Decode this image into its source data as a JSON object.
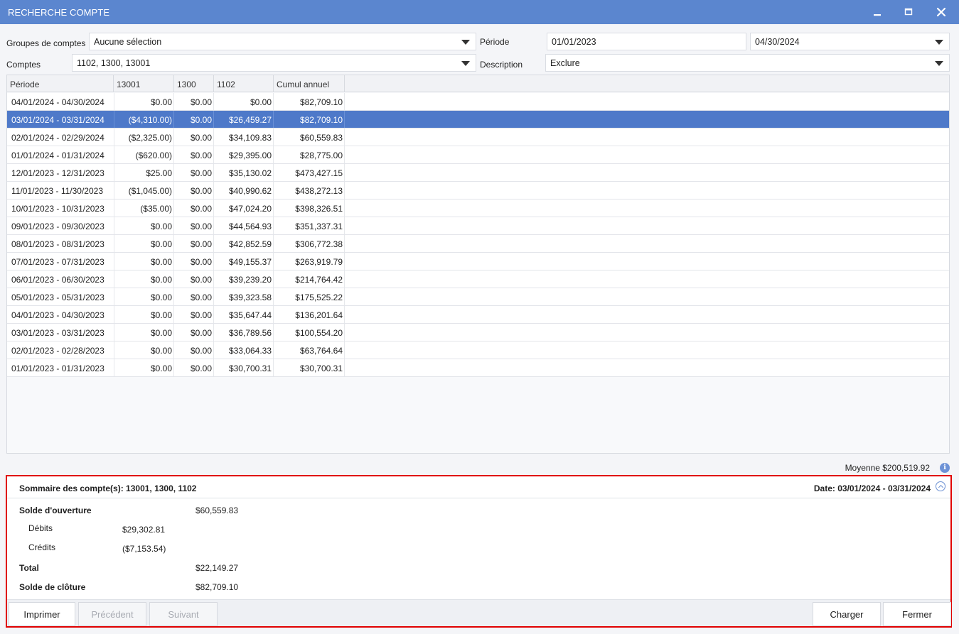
{
  "window": {
    "title": "RECHERCHE COMPTE",
    "minimize_icon": "minimize-icon",
    "maximize_icon": "maximize-icon",
    "close_icon": "close-icon"
  },
  "filters": {
    "account_groups_label": "Groupes de comptes",
    "account_groups_value": "Aucune sélection",
    "accounts_label": "Comptes",
    "accounts_value": "1102, 1300, 13001",
    "period_label": "Période",
    "period_start": "01/01/2023",
    "period_end": "04/30/2024",
    "description_label": "Description",
    "description_value": "Exclure"
  },
  "grid": {
    "columns": [
      "Période",
      "13001",
      "1300",
      "1102",
      "Cumul annuel"
    ],
    "selected_row": 1,
    "rows": [
      [
        "04/01/2024 - 04/30/2024",
        "$0.00",
        "$0.00",
        "$0.00",
        "$82,709.10"
      ],
      [
        "03/01/2024 - 03/31/2024",
        "($4,310.00)",
        "$0.00",
        "$26,459.27",
        "$82,709.10"
      ],
      [
        "02/01/2024 - 02/29/2024",
        "($2,325.00)",
        "$0.00",
        "$34,109.83",
        "$60,559.83"
      ],
      [
        "01/01/2024 - 01/31/2024",
        "($620.00)",
        "$0.00",
        "$29,395.00",
        "$28,775.00"
      ],
      [
        "12/01/2023 - 12/31/2023",
        "$25.00",
        "$0.00",
        "$35,130.02",
        "$473,427.15"
      ],
      [
        "11/01/2023 - 11/30/2023",
        "($1,045.00)",
        "$0.00",
        "$40,990.62",
        "$438,272.13"
      ],
      [
        "10/01/2023 - 10/31/2023",
        "($35.00)",
        "$0.00",
        "$47,024.20",
        "$398,326.51"
      ],
      [
        "09/01/2023 - 09/30/2023",
        "$0.00",
        "$0.00",
        "$44,564.93",
        "$351,337.31"
      ],
      [
        "08/01/2023 - 08/31/2023",
        "$0.00",
        "$0.00",
        "$42,852.59",
        "$306,772.38"
      ],
      [
        "07/01/2023 - 07/31/2023",
        "$0.00",
        "$0.00",
        "$49,155.37",
        "$263,919.79"
      ],
      [
        "06/01/2023 - 06/30/2023",
        "$0.00",
        "$0.00",
        "$39,239.20",
        "$214,764.42"
      ],
      [
        "05/01/2023 - 05/31/2023",
        "$0.00",
        "$0.00",
        "$39,323.58",
        "$175,525.22"
      ],
      [
        "04/01/2023 - 04/30/2023",
        "$0.00",
        "$0.00",
        "$35,647.44",
        "$136,201.64"
      ],
      [
        "03/01/2023 - 03/31/2023",
        "$0.00",
        "$0.00",
        "$36,789.56",
        "$100,554.20"
      ],
      [
        "02/01/2023 - 02/28/2023",
        "$0.00",
        "$0.00",
        "$33,064.33",
        "$63,764.64"
      ],
      [
        "01/01/2023 - 01/31/2023",
        "$0.00",
        "$0.00",
        "$30,700.31",
        "$30,700.31"
      ]
    ]
  },
  "average": {
    "text": "Moyenne $200,519.92",
    "icon": "info-icon"
  },
  "summary": {
    "title": "Sommaire des compte(s): 13001, 1300, 1102",
    "date": "Date: 03/01/2024 - 03/31/2024",
    "collapse_icon": "chevron-up-circle-icon",
    "opening_label": "Solde d'ouverture",
    "opening_value": "$60,559.83",
    "debits_label": "Débits",
    "debits_value": "$29,302.81",
    "credits_label": "Crédits",
    "credits_value": "($7,153.54)",
    "total_label": "Total",
    "total_value": "$22,149.27",
    "closing_label": "Solde de clôture",
    "closing_value": "$82,709.10"
  },
  "buttons": {
    "print": "Imprimer",
    "previous": "Précédent",
    "next": "Suivant",
    "load": "Charger",
    "close": "Fermer"
  },
  "colors": {
    "titlebar": "#5b86cf",
    "selected_row": "#4e79c9",
    "highlight_border": "#e00000"
  }
}
